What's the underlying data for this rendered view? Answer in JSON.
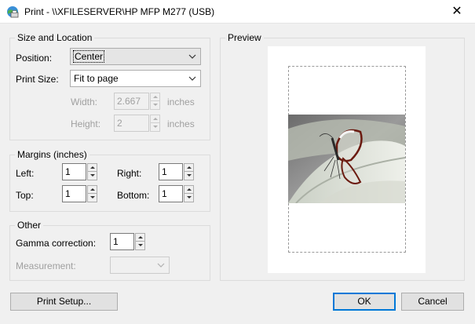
{
  "window": {
    "title": "Print - \\\\XFILESERVER\\HP MFP M277 (USB)",
    "app_icon": "printer-globe-icon",
    "close_icon": "close-icon",
    "close_glyph": "✕"
  },
  "size_location": {
    "legend": "Size and Location",
    "position_label": "Position:",
    "position_value": "Center",
    "print_size_label": "Print Size:",
    "print_size_value": "Fit to page",
    "width_label": "Width:",
    "width_value": "2.667",
    "width_unit": "inches",
    "height_label": "Height:",
    "height_value": "2",
    "height_unit": "inches"
  },
  "margins": {
    "legend": "Margins (inches)",
    "left_label": "Left:",
    "left_value": "1",
    "right_label": "Right:",
    "right_value": "1",
    "top_label": "Top:",
    "top_value": "1",
    "bottom_label": "Bottom:",
    "bottom_value": "1"
  },
  "other": {
    "legend": "Other",
    "gamma_label": "Gamma correction:",
    "gamma_value": "1",
    "measurement_label": "Measurement:",
    "measurement_value": ""
  },
  "preview": {
    "legend": "Preview",
    "image": "glasswing-butterfly-photo"
  },
  "buttons": {
    "print_setup": "Print Setup...",
    "ok": "OK",
    "cancel": "Cancel"
  },
  "colors": {
    "accent": "#0078d7",
    "window_bg": "#f0f0f0"
  }
}
